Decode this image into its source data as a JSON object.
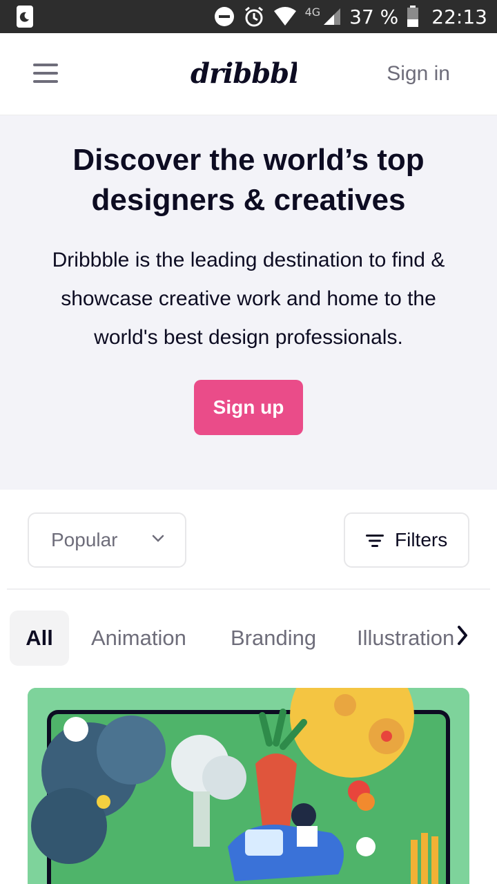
{
  "status_bar": {
    "battery": "37 %",
    "network": "4G",
    "time": "22:13"
  },
  "header": {
    "logo_text": "dribbble",
    "sign_in": "Sign in"
  },
  "hero": {
    "title": "Discover the world’s top designers & creatives",
    "description": "Dribbble is the leading destination to find & showcase creative work and home to the world's best design professionals.",
    "signup_label": "Sign up"
  },
  "controls": {
    "sort_value": "Popular",
    "filters_label": "Filters"
  },
  "tabs": [
    "All",
    "Animation",
    "Branding",
    "Illustration"
  ],
  "colors": {
    "accent": "#ea4c89",
    "hero_bg": "#f3f3f8",
    "shot_bg": "#7ed39b"
  }
}
